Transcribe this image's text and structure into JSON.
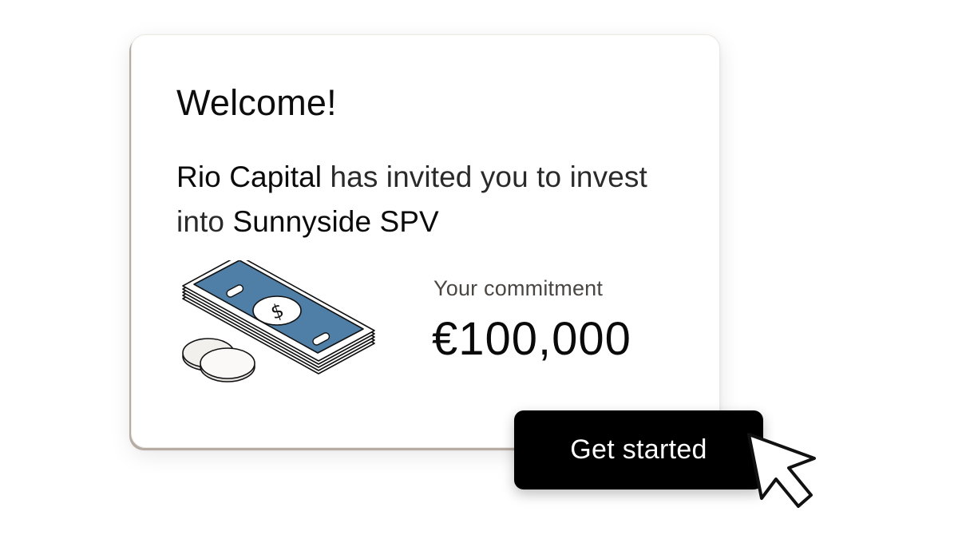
{
  "card": {
    "title": "Welcome!",
    "invite": {
      "sponsor": "Rio Capital",
      "middle": " has invited you to invest into ",
      "deal": "Sunnyside SPV"
    },
    "commitment": {
      "label": "Your commitment",
      "value": "€100,000"
    },
    "illustration_icon": "cash-and-coins-icon"
  },
  "cta": {
    "label": "Get started",
    "background": "#000000",
    "text_color": "#ffffff"
  },
  "cursor": {
    "icon": "pointer-cursor-icon"
  },
  "colors": {
    "banknote": "#4f7fa7",
    "coin": "#e4e2de"
  }
}
